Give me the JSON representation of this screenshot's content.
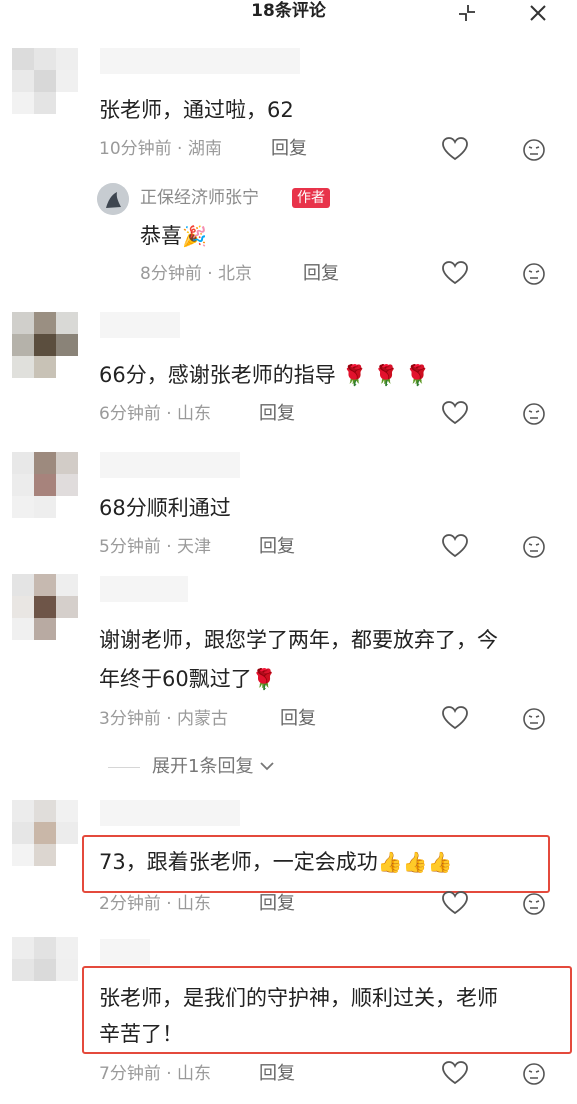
{
  "header": {
    "title": "18条评论",
    "collapse_icon": "collapse-arrows-icon",
    "close_icon": "close-icon"
  },
  "ui": {
    "reply_label": "回复",
    "author_tag": "作者",
    "heart_icon": "heart-outline-icon",
    "dislike_icon": "dislike-face-icon"
  },
  "comments": [
    {
      "text": "张老师，通过啦，62",
      "time": "10分钟前",
      "location": "湖南"
    },
    {
      "text": "66分，感谢张老师的指导",
      "emoji": "🌹 🌹 🌹",
      "time": "6分钟前",
      "location": "山东"
    },
    {
      "text": "68分顺利通过",
      "time": "5分钟前",
      "location": "天津"
    },
    {
      "text_line1": "谢谢老师，跟您学了两年，都要放弃了，今",
      "text_line2": "年终于60飘过了",
      "emoji": "🌹",
      "time": "3分钟前",
      "location": "内蒙古"
    },
    {
      "text": "73，跟着张老师，一定会成功",
      "emoji": "👍👍👍",
      "time": "2分钟前",
      "location": "山东"
    },
    {
      "text_line1": "张老师，是我们的守护神，顺利过关，老师",
      "text_line2": "辛苦了！",
      "time": "7分钟前",
      "location": "山东"
    }
  ],
  "author_reply": {
    "name": "正保经济师张宁",
    "text": "恭喜",
    "emoji": "🎉",
    "time": "8分钟前",
    "location": "北京"
  },
  "expand_replies": "展开1条回复",
  "expand_icon": "chevron-down-icon",
  "accent_color": "#e44a3c"
}
